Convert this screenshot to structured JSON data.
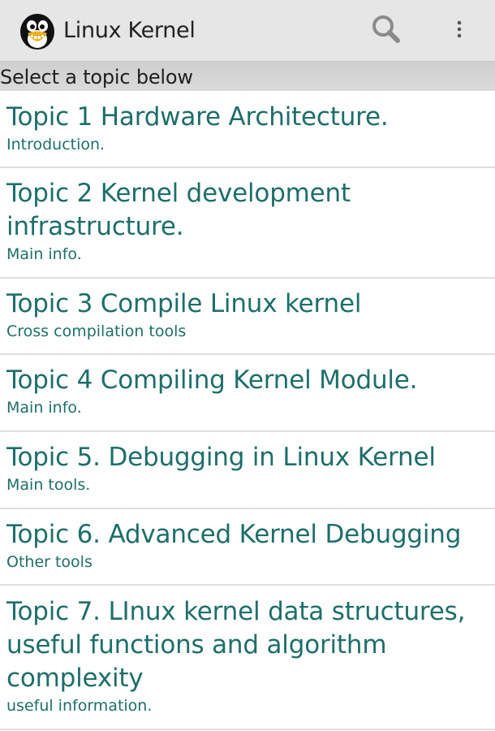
{
  "app": {
    "title": "Linux Kernel",
    "logo_icon": "tux-penguin-logo"
  },
  "toolbar": {
    "search_icon": "search-icon",
    "overflow_icon": "more-vert-icon"
  },
  "list_header": "Select a topic below",
  "colors": {
    "accent": "#1e6e6a",
    "action_bar": "#e6e6e6",
    "header_strip": "#d4d4d4",
    "divider": "#dedede"
  },
  "topics": [
    {
      "title": "Topic 1 Hardware Architecture.",
      "subtitle": "Introduction."
    },
    {
      "title": "Topic 2 Kernel development\ninfrastructure.",
      "subtitle": "Main info."
    },
    {
      "title": "Topic 3 Compile Linux kernel",
      "subtitle": "Cross compilation tools"
    },
    {
      "title": "Topic 4 Compiling Kernel Module.",
      "subtitle": "Main info."
    },
    {
      "title": "Topic 5. Debugging in Linux Kernel",
      "subtitle": "Main tools."
    },
    {
      "title": "Topic 6. Advanced Kernel Debugging",
      "subtitle": "Other tools"
    },
    {
      "title": "Topic 7. LInux kernel data structures,\nuseful functions and algorithm\ncomplexity",
      "subtitle": "useful information."
    }
  ]
}
